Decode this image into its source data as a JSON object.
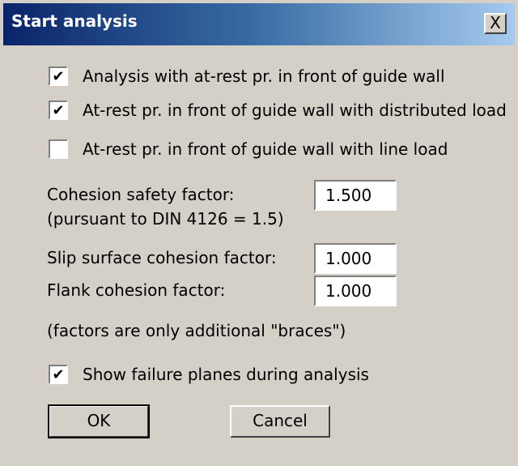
{
  "dialog": {
    "title": "Start analysis",
    "close_label": "X"
  },
  "options": [
    {
      "label": "Analysis with at-rest pr. in front of guide wall",
      "checked": true
    },
    {
      "label": "At-rest pr. in front of guide wall with distributed load",
      "checked": true
    },
    {
      "label": "At-rest pr. in front of guide wall with line load",
      "checked": false
    }
  ],
  "cohesion_safety": {
    "label": "Cohesion safety factor:",
    "note": "(pursuant to DIN 4126 = 1.5)",
    "value": "1.500"
  },
  "slip_surface": {
    "label": "Slip surface cohesion factor:",
    "value": "1.000"
  },
  "flank": {
    "label": "Flank cohesion factor:",
    "value": "1.000"
  },
  "factors_note": "(factors are only additional \"braces\")",
  "show_failure": {
    "label": "Show failure planes during analysis",
    "checked": true
  },
  "buttons": {
    "ok": "OK",
    "cancel": "Cancel"
  }
}
